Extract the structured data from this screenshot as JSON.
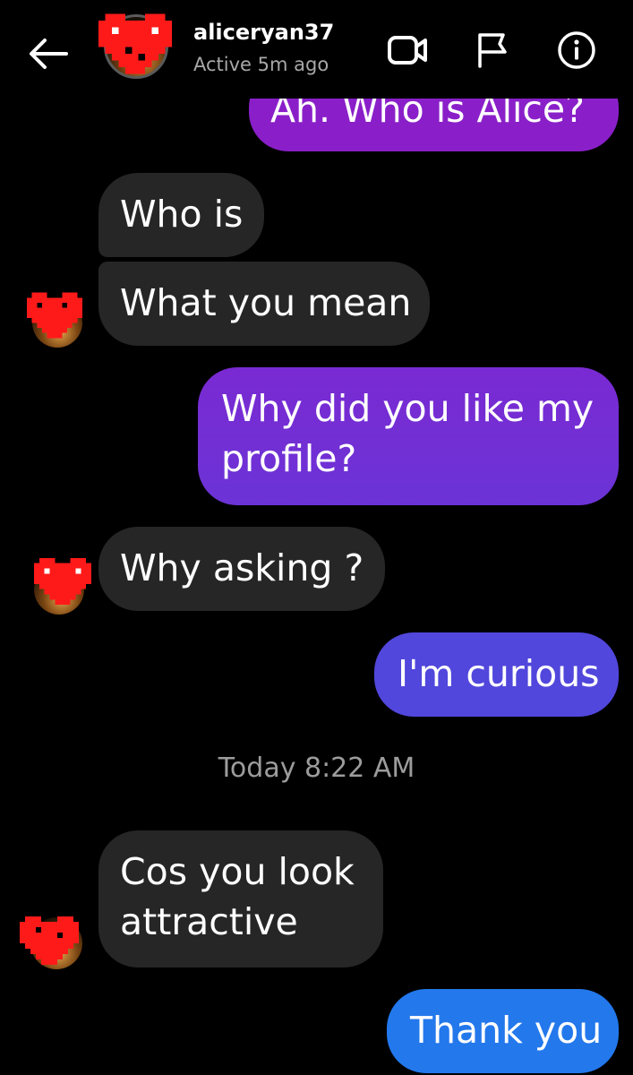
{
  "header": {
    "username": "aliceryan37",
    "status": "Active 5m ago",
    "back_icon": "arrow-left-icon",
    "actions": [
      "video-call-icon",
      "flag-icon",
      "info-icon"
    ]
  },
  "messages": [
    {
      "from": "me",
      "text": "Ah.  Who is Alice?"
    },
    {
      "from": "them",
      "text": "Who is"
    },
    {
      "from": "them",
      "text": "What you mean"
    },
    {
      "from": "me",
      "lines": [
        "Why did you like my",
        "profile?"
      ]
    },
    {
      "from": "them",
      "text": "Why asking ?"
    },
    {
      "from": "me",
      "text": "I'm curious"
    },
    {
      "timestamp": "Today 8:22 AM"
    },
    {
      "from": "them",
      "lines": [
        "Cos you look",
        "attractive"
      ]
    },
    {
      "from": "me",
      "text": "Thank you"
    }
  ],
  "colors": {
    "background": "#000000",
    "received_bubble": "#262626",
    "sent_gradient": [
      "#8a22c8",
      "#6a34d8",
      "#4f4de0",
      "#2a7ff2"
    ],
    "avatar_heart": "#ff1a1a"
  }
}
